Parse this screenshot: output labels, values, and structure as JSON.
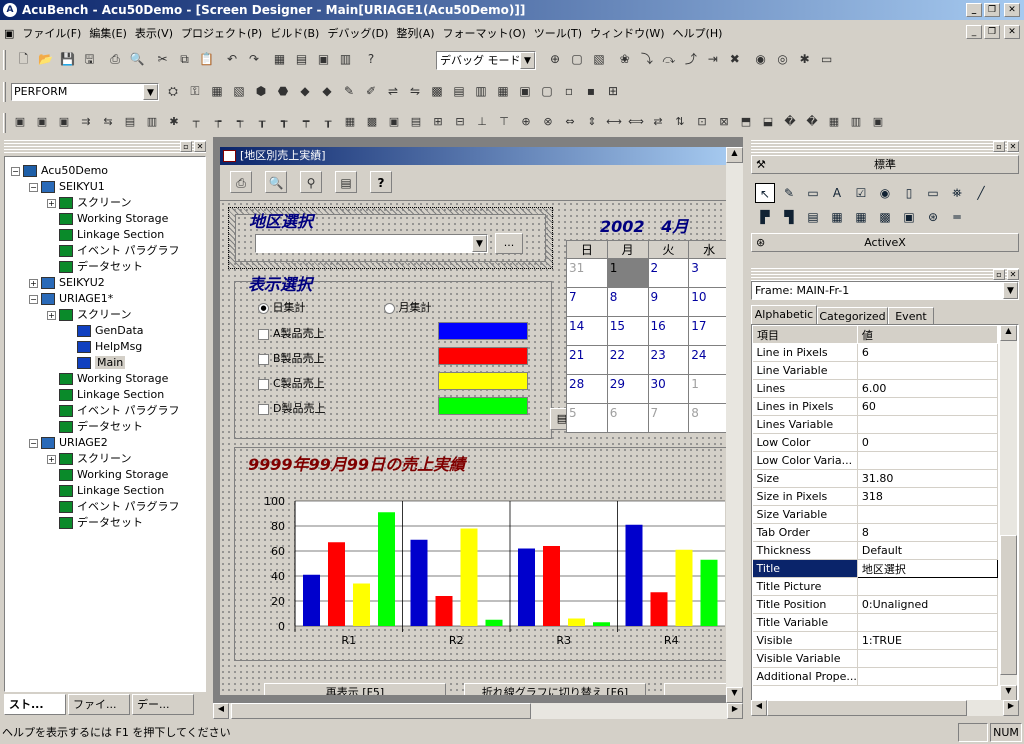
{
  "app": {
    "title": "AcuBench - Acu50Demo - [Screen Designer - Main[URIAGE1(Acu50Demo)]]"
  },
  "menus": [
    "ファイル(F)",
    "編集(E)",
    "表示(V)",
    "プロジェクト(P)",
    "ビルド(B)",
    "デバッグ(D)",
    "整列(A)",
    "フォーマット(O)",
    "ツール(T)",
    "ウィンドウ(W)",
    "ヘルプ(H)"
  ],
  "toolbar": {
    "debug_mode": "デバッグ モード",
    "perform": "PERFORM"
  },
  "tree": {
    "items": [
      {
        "label": "Acu50Demo",
        "level": 0
      },
      {
        "label": "SEIKYU1",
        "level": 1
      },
      {
        "label": "スクリーン",
        "level": 2
      },
      {
        "label": "Working Storage",
        "level": 2
      },
      {
        "label": "Linkage Section",
        "level": 2
      },
      {
        "label": "イベント パラグラフ",
        "level": 2
      },
      {
        "label": "データセット",
        "level": 2
      },
      {
        "label": "SEIKYU2",
        "level": 1
      },
      {
        "label": "URIAGE1*",
        "level": 1
      },
      {
        "label": "スクリーン",
        "level": 2
      },
      {
        "label": "GenData",
        "level": 3
      },
      {
        "label": "HelpMsg",
        "level": 3
      },
      {
        "label": "Main",
        "level": 3
      },
      {
        "label": "Working Storage",
        "level": 2
      },
      {
        "label": "Linkage Section",
        "level": 2
      },
      {
        "label": "イベント パラグラフ",
        "level": 2
      },
      {
        "label": "データセット",
        "level": 2
      },
      {
        "label": "URIAGE2",
        "level": 1
      },
      {
        "label": "スクリーン",
        "level": 2
      },
      {
        "label": "Working Storage",
        "level": 2
      },
      {
        "label": "Linkage Section",
        "level": 2
      },
      {
        "label": "イベント パラグラフ",
        "level": 2
      },
      {
        "label": "データセット",
        "level": 2
      }
    ],
    "tabs": [
      "スト...",
      "ファイ...",
      "デー..."
    ]
  },
  "form": {
    "title": "[地区別売上実績]",
    "area_label": "地区選択",
    "button_ellipsis": "...",
    "display_label": "表示選択",
    "radio_daily": "日集計",
    "radio_monthly": "月集計",
    "checks": [
      {
        "label": "A製品売上",
        "color": "#0000ff"
      },
      {
        "label": "B製品売上",
        "color": "#ff0000"
      },
      {
        "label": "C製品売上",
        "color": "#ffff00"
      },
      {
        "label": "D製品売上",
        "color": "#00ff00"
      }
    ],
    "calendar": {
      "year": "2002",
      "month": "4月",
      "headers": [
        "日",
        "月",
        "火",
        "水"
      ],
      "rows": [
        [
          "31",
          "1",
          "2",
          "3"
        ],
        [
          "7",
          "8",
          "9",
          "10"
        ],
        [
          "14",
          "15",
          "16",
          "17"
        ],
        [
          "21",
          "22",
          "23",
          "24"
        ],
        [
          "28",
          "29",
          "30",
          "1"
        ],
        [
          "5",
          "6",
          "7",
          "8"
        ]
      ]
    },
    "chart_title": "9999年99月99日の売上実績",
    "btn_refresh": "再表示 [F5]",
    "btn_switch": "折れ線グラフに切り替え [F6]"
  },
  "chart_data": {
    "type": "bar",
    "categories": [
      "R1",
      "R2",
      "R3",
      "R4"
    ],
    "ylim": [
      0,
      100
    ],
    "yticks": [
      "100",
      "80",
      "60",
      "40",
      "20",
      "0"
    ],
    "series": [
      {
        "color": "#0000cc",
        "values": [
          41,
          69,
          62,
          81
        ]
      },
      {
        "color": "#ff0000",
        "values": [
          67,
          24,
          64,
          27
        ]
      },
      {
        "color": "#ffff00",
        "values": [
          34,
          78,
          6,
          61
        ]
      },
      {
        "color": "#00ff00",
        "values": [
          91,
          5,
          3,
          53
        ]
      }
    ]
  },
  "toolbox": {
    "title": "標準",
    "activex": "ActiveX"
  },
  "props": {
    "object": "Frame: MAIN-Fr-1",
    "tabs": [
      "Alphabetic",
      "Categorized",
      "Event"
    ],
    "header": [
      "項目",
      "値"
    ],
    "rows": [
      [
        "Line in Pixels",
        "6"
      ],
      [
        "Line Variable",
        ""
      ],
      [
        "Lines",
        "6.00"
      ],
      [
        "Lines in Pixels",
        "60"
      ],
      [
        "Lines Variable",
        ""
      ],
      [
        "Low Color",
        "0"
      ],
      [
        "Low Color Varia...",
        ""
      ],
      [
        "Size",
        "31.80"
      ],
      [
        "Size in Pixels",
        "318"
      ],
      [
        "Size Variable",
        ""
      ],
      [
        "Tab Order",
        "8"
      ],
      [
        "Thickness",
        "Default"
      ],
      [
        "Title",
        "地区選択"
      ],
      [
        "Title Picture",
        ""
      ],
      [
        "Title Position",
        "0:Unaligned"
      ],
      [
        "Title Variable",
        ""
      ],
      [
        "Visible",
        "1:TRUE"
      ],
      [
        "Visible Variable",
        ""
      ],
      [
        "Additional Prope...",
        ""
      ]
    ]
  },
  "status": {
    "text": "ヘルプを表示するには F1 を押下してください",
    "num": "NUM"
  }
}
